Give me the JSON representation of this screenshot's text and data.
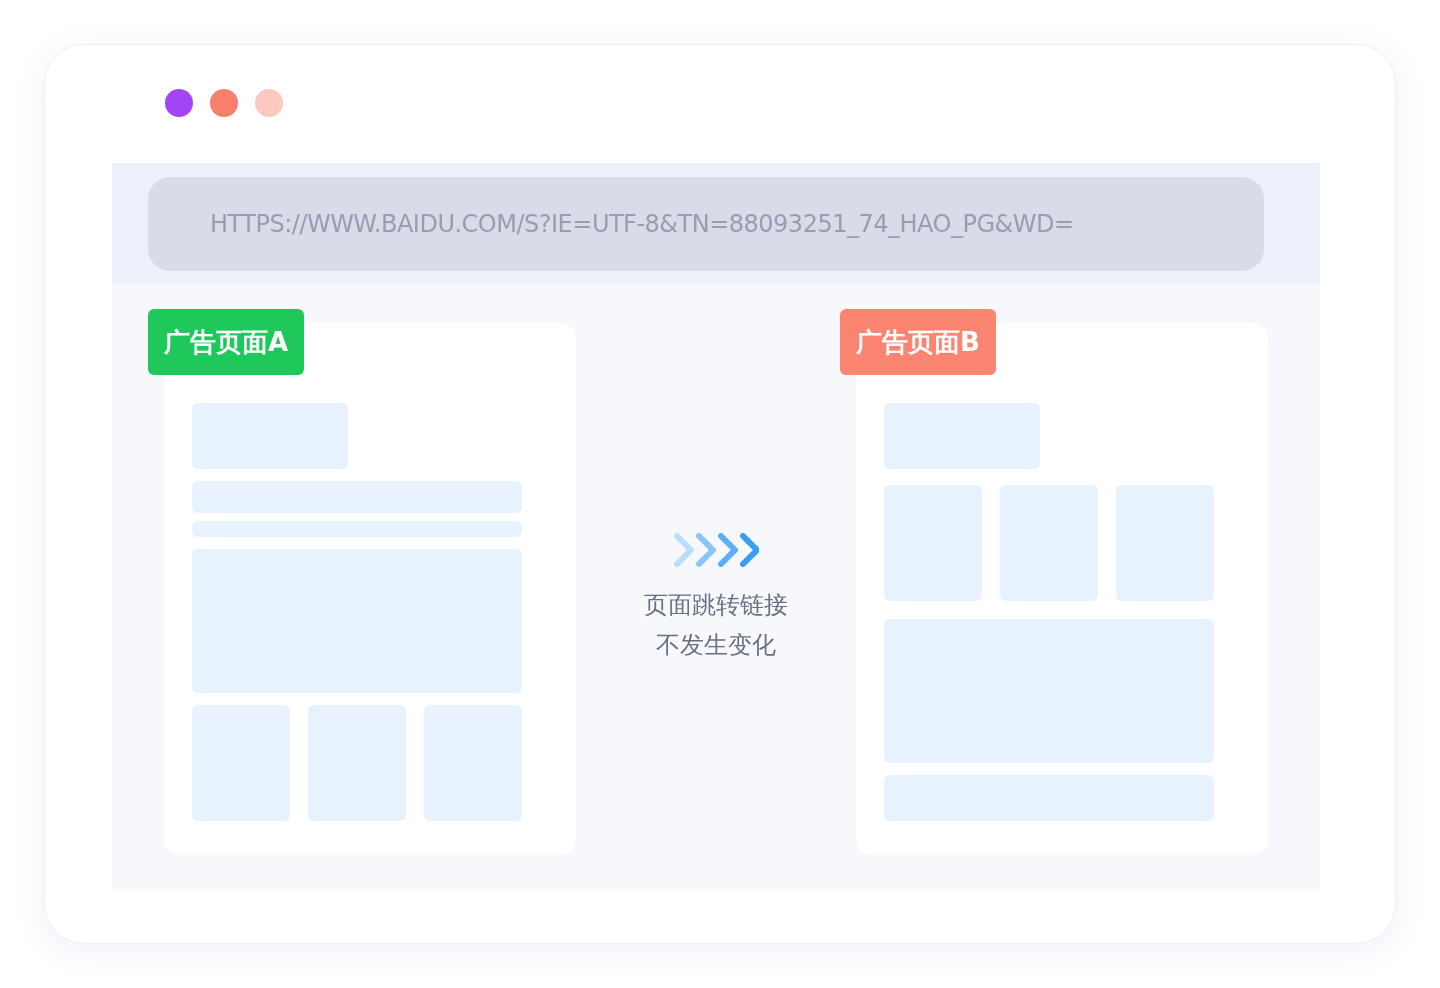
{
  "window_dots": [
    {
      "color": "#a146f5"
    },
    {
      "color": "#f77f6b"
    },
    {
      "color": "#fcc8bf"
    }
  ],
  "address_bar": {
    "url": "HTTPS://WWW.BAIDU.COM/S?IE=UTF-8&TN=88093251_74_HAO_PG&WD="
  },
  "pages": [
    {
      "label": "广告页面A",
      "color": "#1fc85b",
      "kind": "a"
    },
    {
      "label": "广告页面B",
      "color": "#fb8571",
      "kind": "b"
    }
  ],
  "transition": {
    "caption": [
      "页面跳转链接",
      "不发生变化"
    ]
  }
}
